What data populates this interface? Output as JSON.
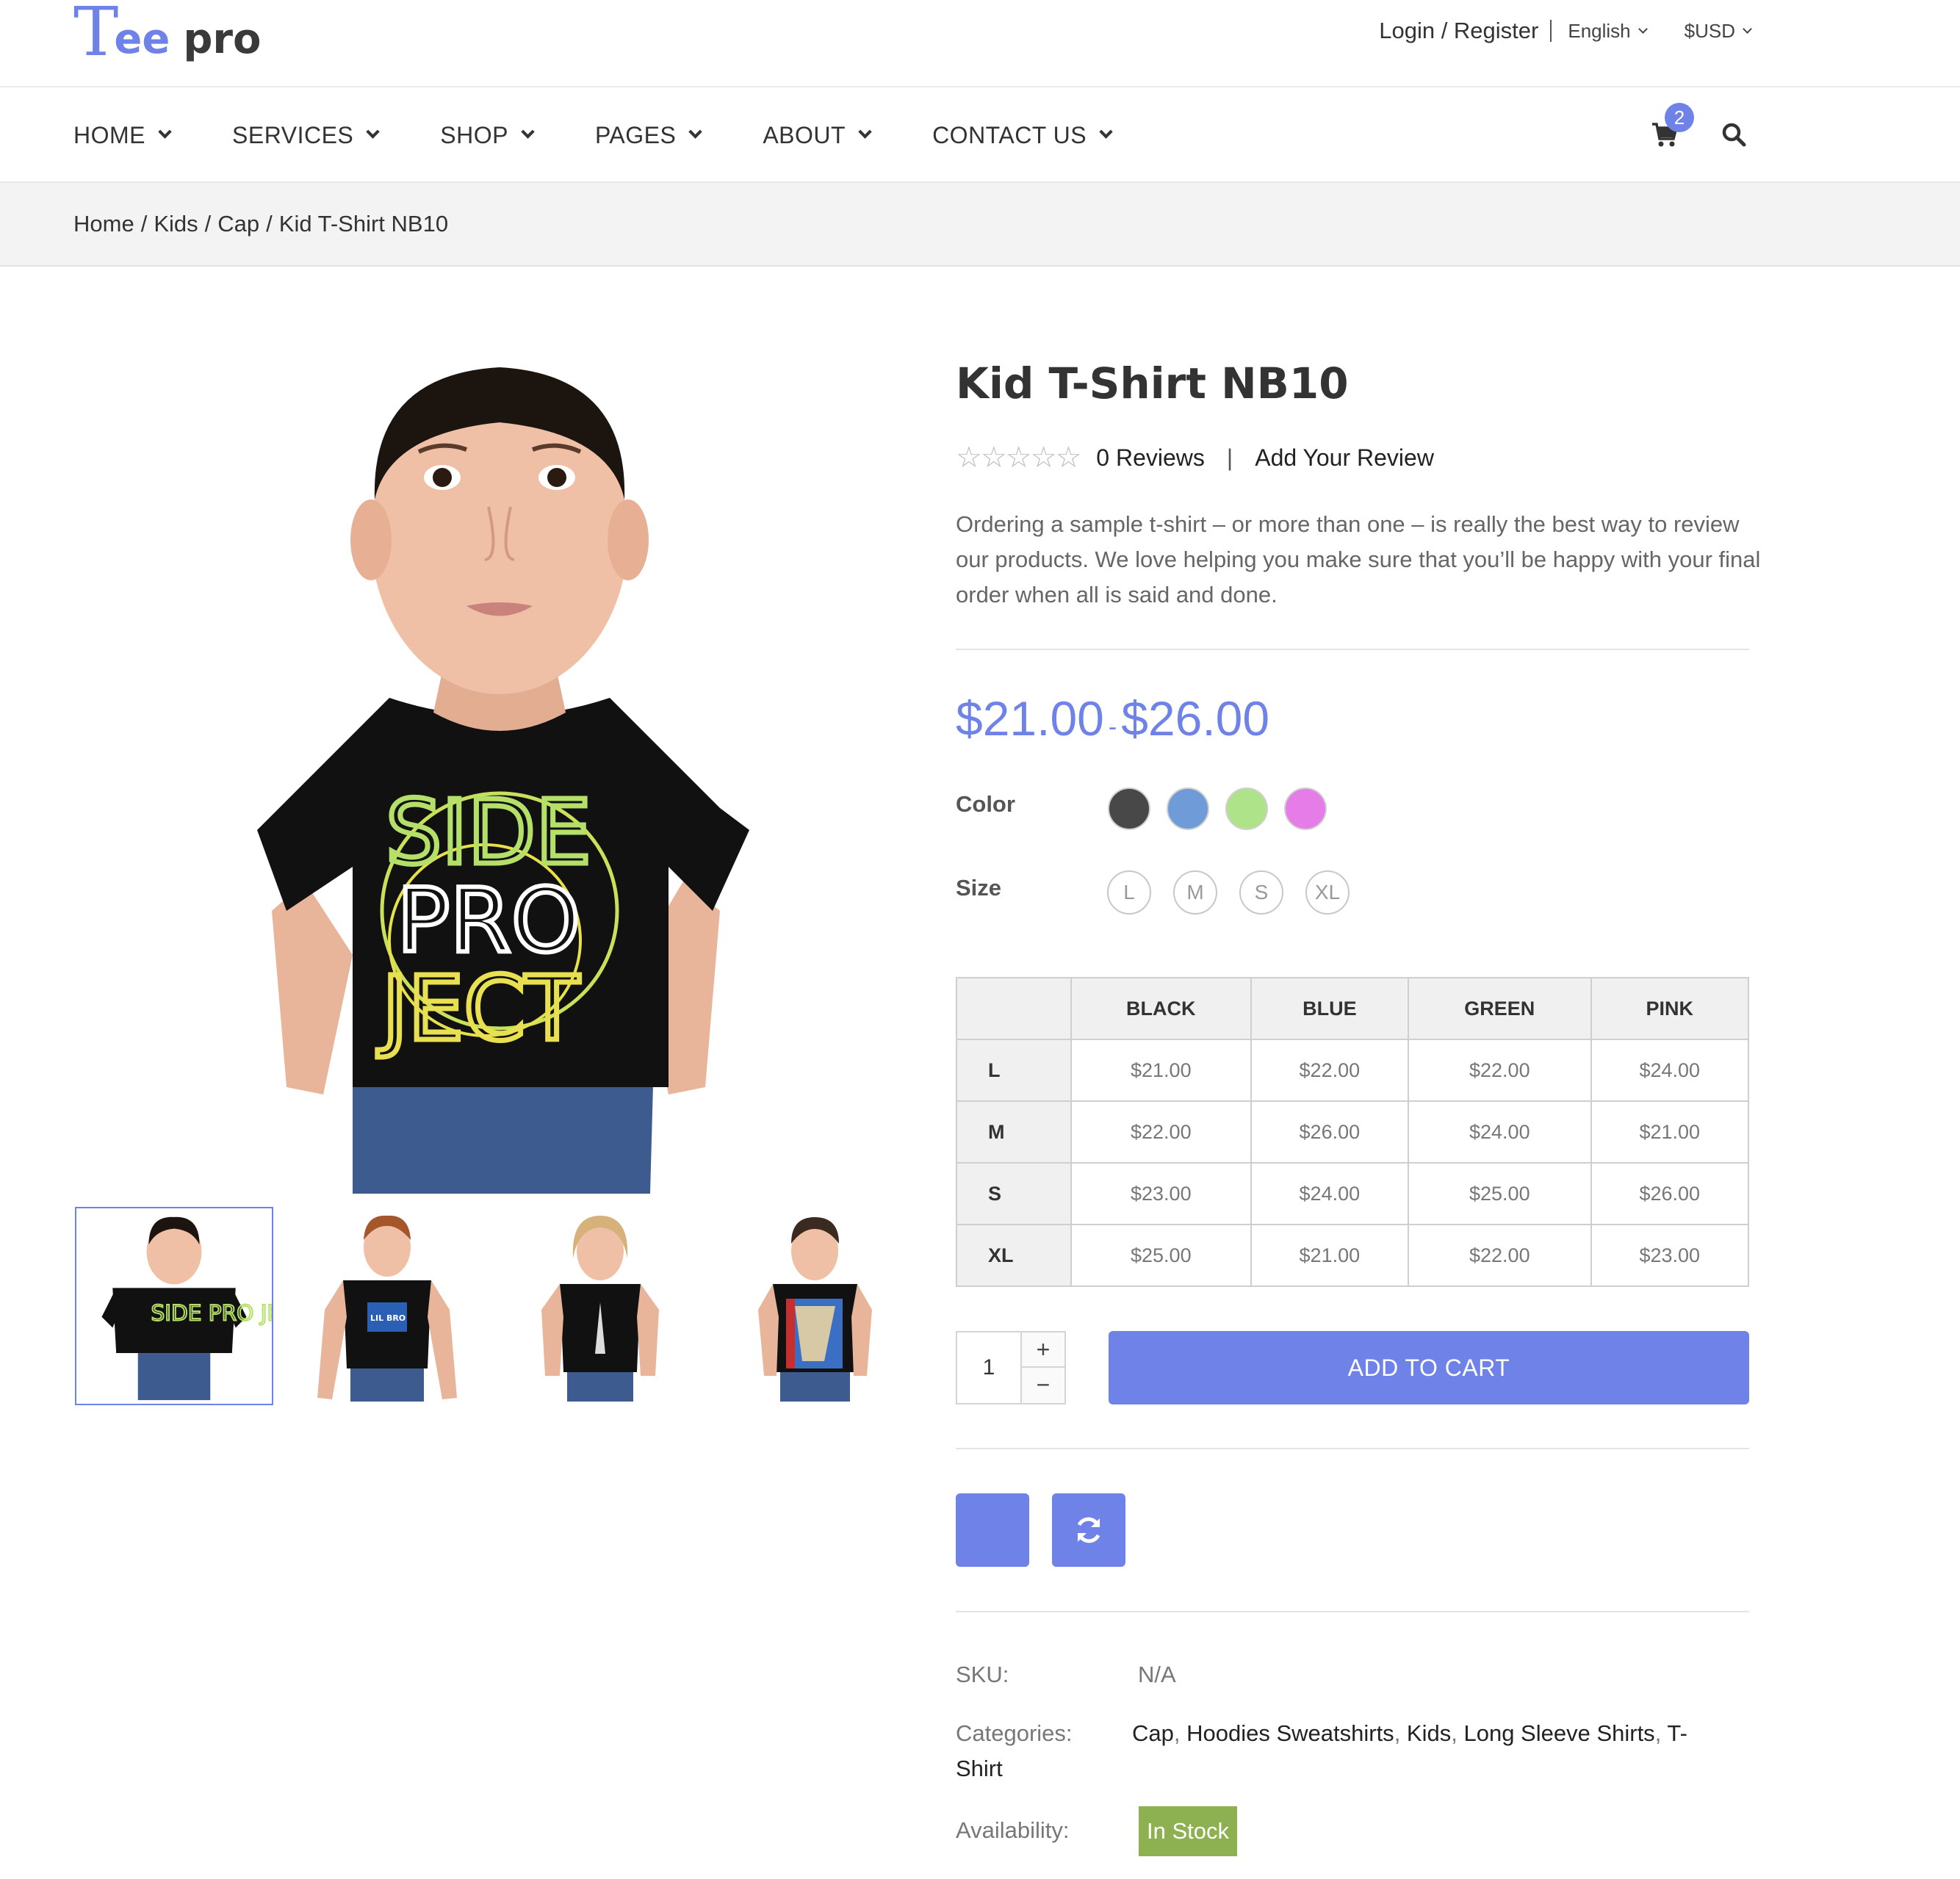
{
  "brand": {
    "logo_mark": "T",
    "logo_text_1": "ee",
    "logo_text_2": "pro"
  },
  "top_links": {
    "login": "Login / Register",
    "language": "English",
    "currency": "$USD"
  },
  "nav": {
    "items": [
      "HOME",
      "SERVICES",
      "SHOP",
      "PAGES",
      "ABOUT",
      "CONTACT US"
    ],
    "cart_count": "2"
  },
  "breadcrumb": [
    "Home",
    "Kids",
    "Cap",
    "Kid T-Shirt NB10"
  ],
  "product": {
    "title": "Kid T-Shirt NB10",
    "reviews": "0 Reviews",
    "add_review": "Add Your Review",
    "description": "Ordering a sample t-shirt – or more than one – is really the best way to review our products. We love helping you make sure that you’ll be happy with your final order when all is said and done.",
    "price_min": "$21.00",
    "price_sep": "-",
    "price_max": "$26.00",
    "rating_stars": 0
  },
  "options": {
    "color_label": "Color",
    "colors": [
      "#484848",
      "#6f9bd8",
      "#aee38a",
      "#e57ce8"
    ],
    "size_label": "Size",
    "sizes": [
      "L",
      "M",
      "S",
      "XL"
    ]
  },
  "price_table": {
    "columns": [
      "",
      "BLACK",
      "BLUE",
      "GREEN",
      "PINK"
    ],
    "rows": [
      {
        "size": "L",
        "prices": [
          "$21.00",
          "$22.00",
          "$22.00",
          "$24.00"
        ]
      },
      {
        "size": "M",
        "prices": [
          "$22.00",
          "$26.00",
          "$24.00",
          "$21.00"
        ]
      },
      {
        "size": "S",
        "prices": [
          "$23.00",
          "$24.00",
          "$25.00",
          "$26.00"
        ]
      },
      {
        "size": "XL",
        "prices": [
          "$25.00",
          "$21.00",
          "$22.00",
          "$23.00"
        ]
      }
    ]
  },
  "cart_form": {
    "quantity": "1",
    "plus": "+",
    "minus": "−",
    "add_to_cart": "ADD TO CART"
  },
  "meta": {
    "sku_label": "SKU:",
    "sku_value": "N/A",
    "categories_label": "Categories:",
    "categories": [
      "Cap",
      "Hoodies Sweatshirts",
      "Kids",
      "Long Sleeve Shirts",
      "T-"
    ],
    "categories_wrap": "Shirt",
    "availability_label": "Availability:",
    "availability_value": "In Stock"
  },
  "thumbnails": [
    {
      "shirt_text": "SIDE PRO JECT"
    },
    {
      "shirt_text": "LIL BRO"
    },
    {
      "shirt_text": ""
    },
    {
      "shirt_text": ""
    }
  ],
  "main_image": {
    "shirt_line_1": "SIDE",
    "shirt_line_2": "PRO",
    "shirt_line_3": "JECT"
  },
  "colors": {
    "accent": "#6f82e8",
    "stock": "#8db051"
  }
}
